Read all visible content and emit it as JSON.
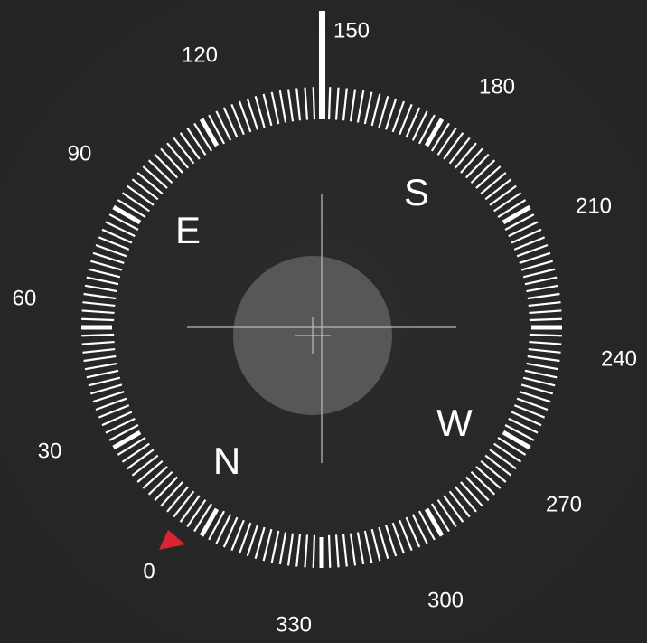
{
  "compass": {
    "heading_degrees": 150,
    "degree_labels": [
      "0",
      "30",
      "60",
      "90",
      "120",
      "150",
      "180",
      "210",
      "240",
      "270",
      "300",
      "330"
    ],
    "cardinals": {
      "north": "N",
      "east": "E",
      "south": "S",
      "west": "W"
    },
    "heading_marker_color": "#ffffff",
    "north_pointer_color": "#d9252f",
    "level_bubble_color": "#5f605e",
    "crosshair_color": "#bdbdbd",
    "tick_color": "#ffffff",
    "background_color": "#262726"
  }
}
